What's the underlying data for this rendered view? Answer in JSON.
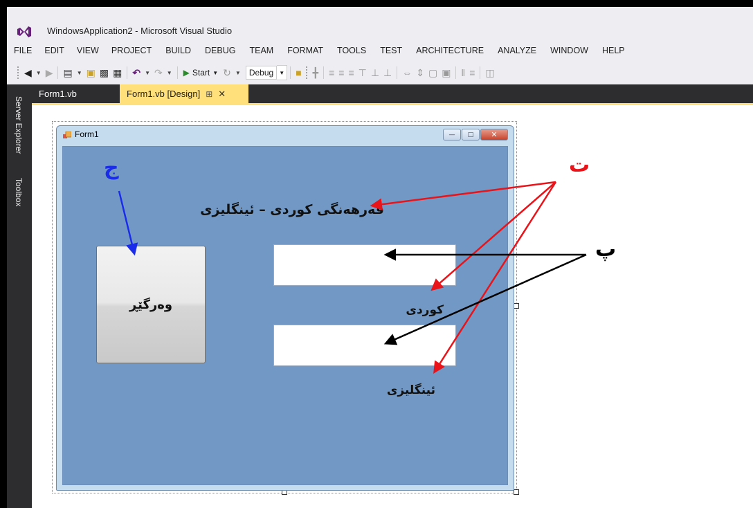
{
  "window": {
    "title": "WindowsApplication2 - Microsoft Visual Studio"
  },
  "menu": [
    "FILE",
    "EDIT",
    "VIEW",
    "PROJECT",
    "BUILD",
    "DEBUG",
    "TEAM",
    "FORMAT",
    "TOOLS",
    "TEST",
    "ARCHITECTURE",
    "ANALYZE",
    "WINDOW",
    "HELP"
  ],
  "toolbar": {
    "start_label": "Start",
    "config_value": "Debug"
  },
  "side_panels": [
    "Server Explorer",
    "Toolbox"
  ],
  "tabs": [
    {
      "label": "Form1.vb",
      "active": false
    },
    {
      "label": "Form1.vb [Design]",
      "active": true
    }
  ],
  "form": {
    "title": "Form1",
    "title_label": "فەرهەنگی کوردی – ئینگلیزی",
    "kurdish_label": "کوردی",
    "english_label": "ئینگلیزی",
    "translate_button": "وەرگێڕ",
    "kurdish_input_value": "",
    "english_input_value": ""
  },
  "annotations": {
    "t": {
      "text": "ت",
      "color": "#e8141a"
    },
    "p": {
      "text": "پ",
      "color": "#000000"
    },
    "j": {
      "text": "ج",
      "color": "#1a2bea"
    }
  },
  "colors": {
    "tab_active": "#ffe07a",
    "form_client": "#7298c5",
    "ide_dark": "#2d2d30"
  }
}
